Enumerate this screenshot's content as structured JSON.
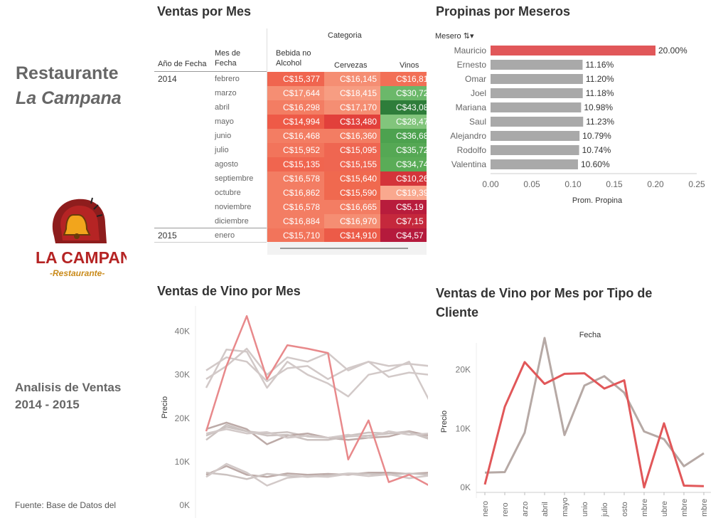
{
  "sidebar": {
    "title_line1": "Restaurante",
    "title_line2": "La Campana",
    "logo_text": "LA CAMPANA",
    "logo_sub": "-Restaurante-",
    "analysis_line1": "Analisis de Ventas",
    "analysis_line2": "2014 - 2015",
    "source": "Fuente: Base de Datos del"
  },
  "sales_table": {
    "title": "Ventas por Mes",
    "col_group": "Categoria",
    "row_header_year": "Año de Fecha",
    "row_header_month_line1": "Mes de",
    "row_header_month_line2": "Fecha",
    "columns": [
      "Bebida no Alcohol",
      "Cervezas",
      "Vinos"
    ],
    "columns_line1": [
      "Bebida no",
      "Cervezas",
      "Vinos"
    ],
    "columns_line2": [
      "Alcohol",
      "",
      ""
    ],
    "rows": [
      {
        "year": "2014",
        "month": "febrero",
        "values": [
          "C$15,377",
          "C$16,145",
          "C$16,81"
        ],
        "colors": [
          "#f0654f",
          "#f58e73",
          "#f26f56"
        ]
      },
      {
        "year": "",
        "month": "marzo",
        "values": [
          "C$17,644",
          "C$18,415",
          "C$30,72"
        ],
        "colors": [
          "#f58e73",
          "#f79d82",
          "#6bb86a"
        ]
      },
      {
        "year": "",
        "month": "abril",
        "values": [
          "C$16,298",
          "C$17,170",
          "C$43,08"
        ],
        "colors": [
          "#f37d63",
          "#f58e73",
          "#2e7d3a"
        ]
      },
      {
        "year": "",
        "month": "mayo",
        "values": [
          "C$14,994",
          "C$13,480",
          "C$28,47"
        ],
        "colors": [
          "#ee5a47",
          "#e2403b",
          "#82c57c"
        ]
      },
      {
        "year": "",
        "month": "junio",
        "values": [
          "C$16,468",
          "C$16,360",
          "C$36,68"
        ],
        "colors": [
          "#f37d63",
          "#f37d63",
          "#4da24f"
        ]
      },
      {
        "year": "",
        "month": "julio",
        "values": [
          "C$15,952",
          "C$15,095",
          "C$35,72"
        ],
        "colors": [
          "#f2745b",
          "#ef6651",
          "#55a854"
        ]
      },
      {
        "year": "",
        "month": "agosto",
        "values": [
          "C$15,135",
          "C$15,155",
          "C$34,74"
        ],
        "colors": [
          "#f0654f",
          "#ef6651",
          "#5aac57"
        ]
      },
      {
        "year": "",
        "month": "septiembre",
        "values": [
          "C$16,578",
          "C$15,640",
          "C$10,26"
        ],
        "colors": [
          "#f37d63",
          "#f0694f",
          "#d4343a"
        ]
      },
      {
        "year": "",
        "month": "octubre",
        "values": [
          "C$16,862",
          "C$15,590",
          "C$19,39"
        ],
        "colors": [
          "#f37d63",
          "#f0694f",
          "#f9a88e"
        ]
      },
      {
        "year": "",
        "month": "noviembre",
        "values": [
          "C$16,578",
          "C$16,665",
          "C$5,19"
        ],
        "colors": [
          "#f37d63",
          "#f37d63",
          "#b81c3c"
        ]
      },
      {
        "year": "",
        "month": "diciembre",
        "values": [
          "C$16,884",
          "C$16,970",
          "C$7,15"
        ],
        "colors": [
          "#f37d63",
          "#f58e73",
          "#c5283c"
        ]
      },
      {
        "year": "2015",
        "month": "enero",
        "values": [
          "C$15,710",
          "C$14,910",
          "C$4,57"
        ],
        "colors": [
          "#f2745b",
          "#ec5b48",
          "#b51a3c"
        ]
      }
    ]
  },
  "chart_data": [
    {
      "type": "bar",
      "title": "Propinas por Meseros",
      "filter_label": "Mesero",
      "categories": [
        "Mauricio",
        "Ernesto",
        "Omar",
        "Joel",
        "Mariana",
        "Saul",
        "Alejandro",
        "Rodolfo",
        "Valentina"
      ],
      "values": [
        0.2,
        0.1116,
        0.112,
        0.1118,
        0.1098,
        0.1123,
        0.1079,
        0.1074,
        0.106
      ],
      "value_labels": [
        "20.00%",
        "11.16%",
        "11.20%",
        "11.18%",
        "10.98%",
        "11.23%",
        "10.79%",
        "10.74%",
        "10.60%"
      ],
      "xlabel": "Prom. Propina",
      "xlim": [
        0,
        0.25
      ],
      "xticks": [
        "0.00",
        "0.05",
        "0.10",
        "0.15",
        "0.20",
        "0.25"
      ],
      "highlight_color": "#e15759",
      "base_color": "#a9a9a9",
      "orientation": "horizontal"
    },
    {
      "type": "line",
      "title": "Ventas de Vino por Mes",
      "ylabel": "Precio",
      "ylim": [
        0,
        45000
      ],
      "yticks": [
        "0K",
        "10K",
        "20K",
        "30K",
        "40K"
      ],
      "x": [
        1,
        2,
        3,
        4,
        5,
        6,
        7,
        8,
        9,
        10,
        11,
        12
      ],
      "series": [
        {
          "values": [
            17000,
            32000,
            43500,
            29000,
            36800,
            36000,
            35000,
            10500,
            19500,
            5300,
            7000,
            4500
          ],
          "color": "#e8898b",
          "highlight": true
        },
        {
          "values": [
            27000,
            35800,
            35300,
            27000,
            33000,
            30000,
            28000,
            25000,
            30000,
            31000,
            33000,
            24000
          ],
          "color": "#d2c9c8"
        },
        {
          "values": [
            29000,
            32000,
            36000,
            30000,
            34000,
            33000,
            35000,
            31000,
            33000,
            32000,
            32500,
            32000
          ],
          "color": "#d2c9c8"
        },
        {
          "values": [
            31000,
            34000,
            33000,
            28500,
            31500,
            32000,
            29000,
            31500,
            33000,
            29500,
            30500,
            30000
          ],
          "color": "#d2c9c8"
        },
        {
          "values": [
            16000,
            18000,
            17000,
            16500,
            16800,
            15800,
            15500,
            16000,
            16700,
            16500,
            17000,
            15500
          ],
          "color": "#cbc2c0"
        },
        {
          "values": [
            17500,
            19000,
            17500,
            14000,
            16000,
            16500,
            15500,
            15000,
            15500,
            15800,
            17000,
            16000
          ],
          "color": "#bcaaa7"
        },
        {
          "values": [
            15000,
            18500,
            17000,
            16000,
            16200,
            15000,
            15000,
            15800,
            16000,
            16500,
            16800,
            15200
          ],
          "color": "#cbc2c0"
        },
        {
          "values": [
            16500,
            17500,
            16500,
            16800,
            15500,
            16000,
            15500,
            16200,
            15500,
            17000,
            16200,
            16500
          ],
          "color": "#d2c9c8"
        },
        {
          "values": [
            7000,
            9000,
            7000,
            6500,
            7300,
            7000,
            7200,
            7000,
            7500,
            7500,
            7200,
            7500
          ],
          "color": "#bcaaa7"
        },
        {
          "values": [
            7500,
            7000,
            6000,
            7200,
            6800,
            6500,
            6800,
            7300,
            7200,
            7000,
            7300,
            7000
          ],
          "color": "#cbc2c0"
        },
        {
          "values": [
            6500,
            9500,
            7500,
            4500,
            6300,
            6700,
            6500,
            7200,
            6700,
            7100,
            6200,
            6800
          ],
          "color": "#d2c9c8"
        }
      ]
    },
    {
      "type": "line",
      "title": "Ventas de Vino por Mes por Tipo de Cliente",
      "title_line1": "Ventas de Vino por Mes por Tipo de",
      "title_line2": "Cliente",
      "top_label": "Fecha",
      "ylabel": "Precio",
      "ylim": [
        0,
        26000
      ],
      "yticks": [
        "0K",
        "10K",
        "20K"
      ],
      "categories": [
        "enero",
        "febrero",
        "marzo",
        "abril",
        "mayo",
        "junio",
        "julio",
        "agosto",
        "septiembre",
        "octubre",
        "noviembre",
        "diciembre"
      ],
      "categories_visible": [
        "nero",
        "rero",
        "arzo",
        "abril",
        "mayo",
        "unio",
        "julio",
        "osto",
        "mbre",
        "ubre",
        "mbre",
        "mbre"
      ],
      "series": [
        {
          "values": [
            500,
            13700,
            21300,
            17600,
            19300,
            19400,
            16800,
            18200,
            0,
            10900,
            300,
            200
          ],
          "color": "#e15759"
        },
        {
          "values": [
            2500,
            2600,
            9300,
            25400,
            8900,
            17300,
            18900,
            16100,
            9500,
            8200,
            3600,
            5800
          ],
          "color": "#b6a9a5"
        }
      ]
    }
  ]
}
